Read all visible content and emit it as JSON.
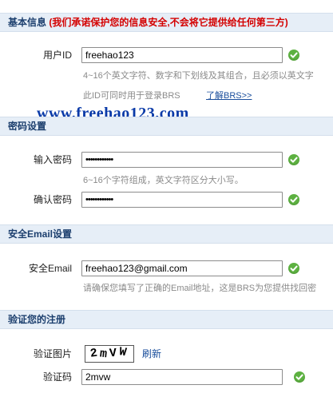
{
  "sections": {
    "basic": {
      "title": "基本信息",
      "notice": "(我们承诺保护您的信息安全,不会将它提供给任何第三方)"
    },
    "password": {
      "title": "密码设置"
    },
    "email": {
      "title": "安全Email设置"
    },
    "verify": {
      "title": "验证您的注册"
    }
  },
  "fields": {
    "user_id": {
      "label": "用户ID",
      "value": "freehao123",
      "hint": "4~16个英文字符、数字和下划线及其组合，且必须以英文字",
      "note": "此ID可同时用于登录BRS",
      "link": "了解BRS>>"
    },
    "password": {
      "label": "输入密码",
      "value": "••••••••••••",
      "hint": "6~16个字符组成，英文字符区分大小写。"
    },
    "confirm_password": {
      "label": "确认密码",
      "value": "••••••••••••"
    },
    "email": {
      "label": "安全Email",
      "value": "freehao123@gmail.com",
      "hint": "请确保您填写了正确的Email地址，这是BRS为您提供找回密"
    },
    "captcha_image": {
      "label": "验证图片",
      "chars": [
        "2",
        "m",
        "V",
        "W"
      ],
      "refresh": "刷新"
    },
    "captcha": {
      "label": "验证码",
      "value": "2mvw"
    }
  },
  "watermark": "www.freehao123.com",
  "colors": {
    "check": "#5db141",
    "header_bg": "#e6eef7",
    "warn": "#d40000",
    "link": "#1a4e9c",
    "watermark": "#0a3aa8"
  },
  "icons": {
    "valid": "check-circle-icon"
  }
}
